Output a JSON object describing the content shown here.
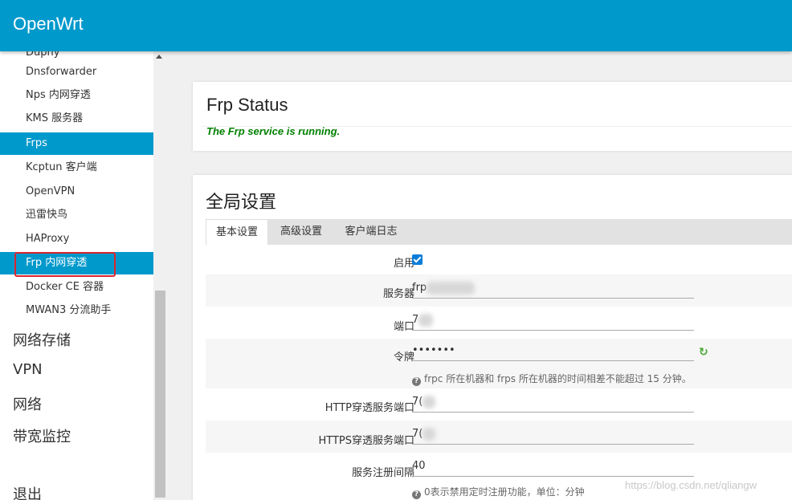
{
  "app": {
    "brand": "OpenWrt"
  },
  "sidebar": {
    "partial_item": "Dupny",
    "sub_items": [
      {
        "label": "Dnsforwarder"
      },
      {
        "label": "Nps 内网穿透"
      },
      {
        "label": "KMS 服务器"
      },
      {
        "label": "Frps"
      },
      {
        "label": "Kcptun 客户端"
      },
      {
        "label": "OpenVPN"
      },
      {
        "label": "迅雷快鸟"
      },
      {
        "label": "HAProxy"
      },
      {
        "label": "Frp 内网穿透"
      },
      {
        "label": "Docker CE 容器"
      },
      {
        "label": "MWAN3 分流助手"
      }
    ],
    "menu_items": [
      {
        "label": "网络存储"
      },
      {
        "label": "VPN"
      },
      {
        "label": "网络"
      },
      {
        "label": "带宽监控"
      },
      {
        "label": "退出"
      }
    ]
  },
  "status": {
    "title": "Frp Status",
    "message": "The Frp service is running."
  },
  "global": {
    "title": "全局设置",
    "tabs": [
      {
        "label": "基本设置"
      },
      {
        "label": "高级设置"
      },
      {
        "label": "客户端日志"
      }
    ],
    "fields": {
      "enable_label": "启用",
      "server_label": "服务器",
      "server_value": "frp",
      "port_label": "端口",
      "port_value": "7",
      "token_label": "令牌",
      "token_value": "•••••••",
      "token_hint": "frpc 所在机器和 frps 所在机器的时间相差不能超过 15 分钟。",
      "http_label": "HTTP穿透服务端口",
      "http_value": "7(",
      "https_label": "HTTPS穿透服务端口",
      "https_value": "7(",
      "interval_label": "服务注册间隔",
      "interval_value": "40",
      "interval_hint": "0表示禁用定时注册功能，单位：分钟"
    }
  },
  "watermark": "https://blog.csdn.net/qliangw"
}
